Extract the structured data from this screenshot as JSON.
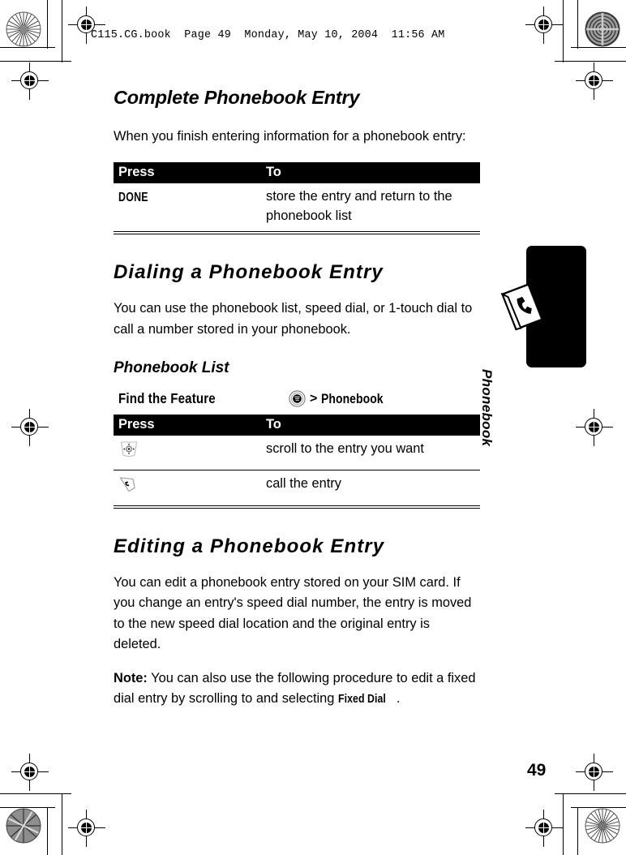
{
  "header": {
    "text": "C115.CG.book  Page 49  Monday, May 10, 2004  11:56 AM"
  },
  "page_number": "49",
  "margin_tab": {
    "label": "Phonebook",
    "icon": "address-book-icon",
    "color": "#000000"
  },
  "sections": [
    {
      "id": "complete-phonebook-entry",
      "heading": "Complete Phonebook Entry",
      "paragraph": "When you finish entering information for a phonebook entry:",
      "table": {
        "headers": [
          "Press",
          "To"
        ],
        "rows": [
          {
            "key": "DONE",
            "key_type": "softkey-label",
            "action": "store the entry and return to the phonebook list"
          }
        ]
      }
    },
    {
      "id": "dialing-a-phonebook-entry",
      "heading": "Dialing a Phonebook Entry",
      "paragraph": "You can use the phonebook list, speed dial, or 1-touch dial to call a number stored in your phonebook.",
      "subheading": "Phonebook List",
      "find_the_feature": {
        "label": "Find the Feature",
        "icon": "menu-key-icon",
        "separator": ">",
        "target": "Phonebook"
      },
      "table": {
        "headers": [
          "Press",
          "To"
        ],
        "rows": [
          {
            "key": "",
            "key_type": "nav-key-icon",
            "action": "scroll to the entry you want"
          },
          {
            "key": "",
            "key_type": "send-key-icon",
            "action": "call the entry"
          }
        ]
      }
    },
    {
      "id": "editing-a-phonebook-entry",
      "heading": "Editing a Phonebook Entry",
      "paragraph": "You can edit a phonebook entry stored on your SIM card. If you change an entry's speed dial number, the entry is moved to the new speed dial location and the original entry is deleted.",
      "note_lead": "Note:",
      "note_body_before": " You can also use the following procedure to edit a fixed dial entry by scrolling to and selecting ",
      "note_keyword": "Fixed Dial",
      "note_body_after": "."
    }
  ]
}
